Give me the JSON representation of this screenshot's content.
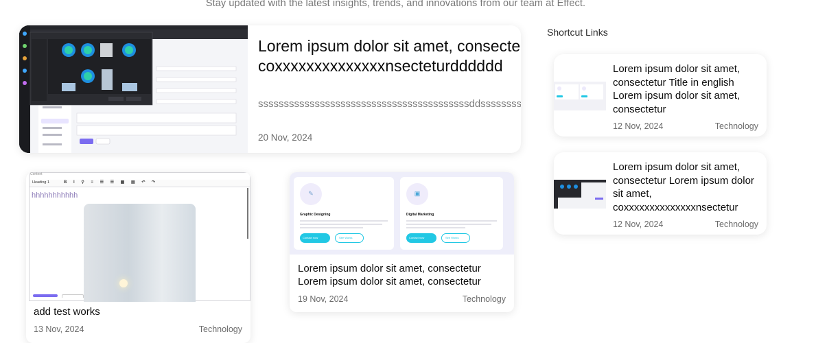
{
  "header": {
    "subtitle": "Stay updated with the latest insights, trends, and innovations from our team at Effect."
  },
  "featured": {
    "title": "Lorem ipsum dolor sit amet, consectetur coxxxxxxxxxxxxxxnsecteturdddddd",
    "title_line1": "Lorem ipsum dolor sit amet, consecte",
    "title_line2": "coxxxxxxxxxxxxxxnsecteturdddddd",
    "excerpt": "sssssssssssssssssssssssssssssssssssssssssddsssssssssssssss",
    "date": "20 Nov, 2024"
  },
  "sidebar": {
    "heading": "Shortcut Links",
    "items": [
      {
        "title": "Lorem ipsum dolor sit amet, consectetur Title in english Lorem ipsum dolor sit amet, consectetur",
        "date": "12 Nov, 2024",
        "category": "Technology"
      },
      {
        "title": "Lorem ipsum dolor sit amet, consectetur Lorem ipsum dolor sit amet, coxxxxxxxxxxxxxxnsectetur",
        "date": "12 Nov, 2024",
        "category": "Technology"
      }
    ]
  },
  "posts": [
    {
      "title": "add test works",
      "date": "13 Nov, 2024",
      "category": "Technology",
      "thumb": {
        "field_label": "Content",
        "heading_select": "Heading 1",
        "body_text": "hhhhhhhhhhh"
      }
    },
    {
      "title": "Lorem ipsum dolor sit amet, consectetur Lorem ipsum dolor sit amet, consectetur",
      "date": "19 Nov, 2024",
      "category": "Technology",
      "thumb": {
        "services": [
          {
            "name": "Graphic Designing",
            "primary": "Contact now",
            "secondary": "See Works"
          },
          {
            "name": "Digital Marketing",
            "primary": "Contact now",
            "secondary": "See Works"
          }
        ]
      }
    }
  ],
  "colors": {
    "accent_purple": "#7b6cf0",
    "accent_cyan": "#22c8e4",
    "text_muted": "#6b6b6b"
  }
}
